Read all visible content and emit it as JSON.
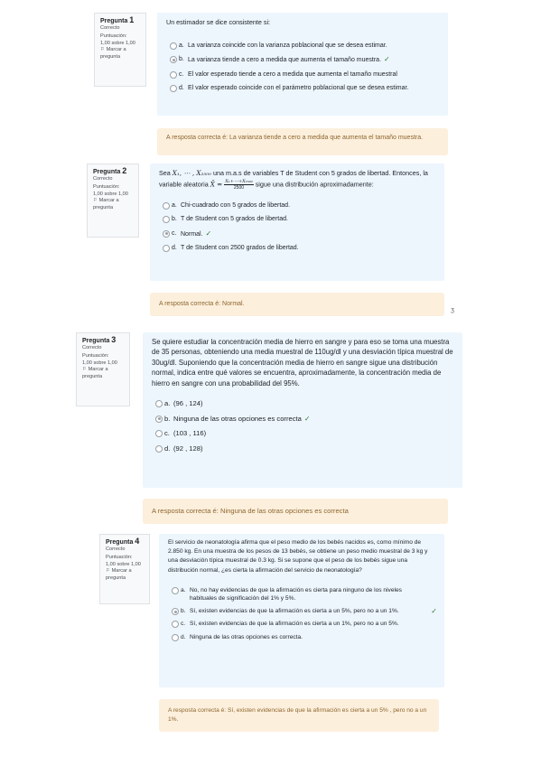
{
  "questions": [
    {
      "title_prefix": "Pregunta",
      "number": "1",
      "state": "Correcto",
      "score_label": "Puntuación:",
      "score": "1,00 sobre 1,00",
      "flag_text": "Marcar a pregunta",
      "stem": "Un estimador se dice consistente si:",
      "options": [
        {
          "letter": "a.",
          "text": "La varianza coincide con la varianza poblacional que se desea estimar.",
          "checked": false
        },
        {
          "letter": "b.",
          "text": "La varianza tiende a cero a medida que aumenta el tamaño muestra.",
          "checked": true
        },
        {
          "letter": "c.",
          "text": "El valor esperado tiende a cero a medida que aumenta el tamaño muestral",
          "checked": false
        },
        {
          "letter": "d.",
          "text": "El valor esperado coincide con el parámetro poblacional que se desea estimar.",
          "checked": false
        }
      ],
      "feedback": "A resposta correcta é: La varianza tiende a cero a medida que aumenta el tamaño muestra."
    },
    {
      "title_prefix": "Pregunta",
      "number": "2",
      "state": "Correcto",
      "score_label": "Puntuación:",
      "score": "1,00 sobre 1,00",
      "flag_text": "Marcar a pregunta",
      "stem_parts": {
        "p1": "Sea ",
        "math1": "X₁, ⋯ , X₂₅₀₀",
        "p2": " una m.a.s de variables T de Student con 5 grados de libertad. Entonces, la variable aleatoria ",
        "math2": "X̄ =",
        "frac_num": "X₁+⋯+X₂₅₀₀",
        "frac_den": "2500",
        "p3": " sigue una distribución aproximadamente:"
      },
      "options": [
        {
          "letter": "a.",
          "text": "Chi-cuadrado con 5 grados de libertad.",
          "checked": false
        },
        {
          "letter": "b.",
          "text": "T de Student con 5 grados de libertad.",
          "checked": false
        },
        {
          "letter": "c.",
          "text": "Normal.",
          "checked": true
        },
        {
          "letter": "d.",
          "text": "T de Student con 2500 grados de libertad.",
          "checked": false
        }
      ],
      "feedback": "A resposta correcta é: Normal."
    },
    {
      "title_prefix": "Pregunta",
      "number": "3",
      "state": "Correcto",
      "score_label": "Puntuación:",
      "score": "1,00 sobre 1,00",
      "flag_text": "Marcar a pregunta",
      "stem": "Se quiere estudiar la concentración media de hierro en sangre y para eso se toma una muestra de 35 personas, obteniendo una media muestral de 110ug/dl y una desviación típica muestral de 30ug/dl. Suponiendo que la concentración media de hierro en sangre sigue una distribución normal, indica entre qué valores se encuentra, aproximadamente, la concentración media de hierro en sangre con una probabilidad del 95%.",
      "options": [
        {
          "letter": "a.",
          "text": "(96 , 124)",
          "checked": false
        },
        {
          "letter": "b.",
          "text": "Ninguna de las otras opciones es correcta",
          "checked": true
        },
        {
          "letter": "c.",
          "text": "(103 , 116)",
          "checked": false
        },
        {
          "letter": "d.",
          "text": "(92 , 128)",
          "checked": false
        }
      ],
      "feedback": "A resposta correcta é: Ninguna de las otras opciones es correcta"
    },
    {
      "title_prefix": "Pregunta",
      "number": "4",
      "state": "Correcto",
      "score_label": "Puntuación:",
      "score": "1,00 sobre 1,00",
      "flag_text": "Marcar a pregunta",
      "stem": "El servicio de neonatología afirma que el peso medio de los bebés nacidos es, como mínimo de 2.850 kg. En una muestra de los pesos de 13 bebés, se obtiene un peso medio muestral de 3 kg y una desviación típica muestral de 0.3 kg. Si se supone que el peso de los bebés sigue una distribución normal, ¿es cierta la afirmación del servicio de neonatología?",
      "options": [
        {
          "letter": "a.",
          "text": "No, no hay evidencias de que la afirmación es cierta para ninguno de los niveles habituales de significación del 1% y 5%.",
          "checked": false
        },
        {
          "letter": "b.",
          "text": "Sí, existen evidencias de que la afirmación es cierta a un 5%, pero no a un 1%.",
          "checked": true
        },
        {
          "letter": "c.",
          "text": "Sí, existen evidencias de que la afirmación es cierta a un 1%, pero no a un 5%.",
          "checked": false
        },
        {
          "letter": "d.",
          "text": "Ninguna de las otras opciones es correcta.",
          "checked": false
        }
      ],
      "feedback": "A resposta correcta é: Sí, existen evidencias de que la afirmación es cierta a un 5% , pero no a un 1%."
    }
  ],
  "check_mark": "✓",
  "flag_icon": "flag-icon",
  "side_glyph": "ʒ",
  "colors": {
    "content_bg": "#edf6fd",
    "feedback_bg": "#fcefdc",
    "feedback_text": "#8e662e",
    "check": "#357a32"
  }
}
